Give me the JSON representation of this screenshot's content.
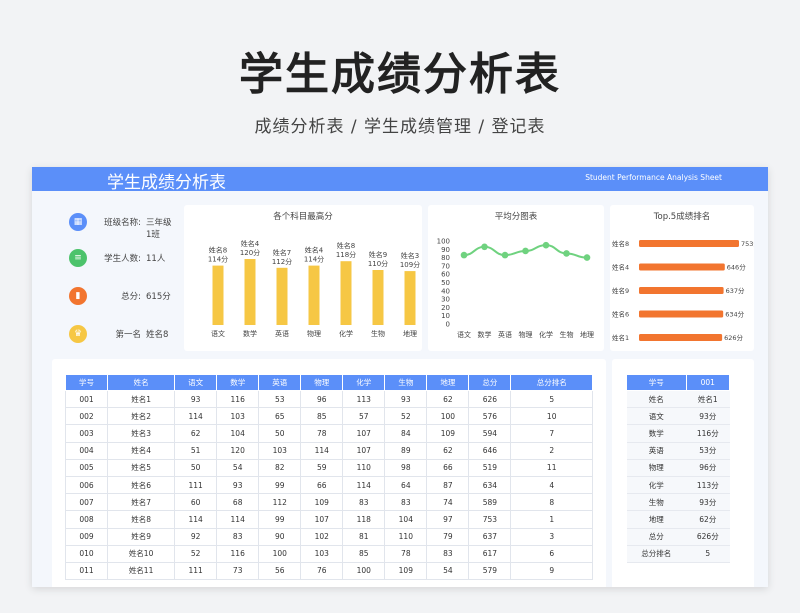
{
  "page": {
    "title": "学生成绩分析表",
    "subtitle": "成绩分析表 / 学生成绩管理 / 登记表"
  },
  "banner": {
    "title": "学生成绩分析表",
    "subtitle_en": "Student Performance Analysis Sheet"
  },
  "info": {
    "items": [
      {
        "label": "班级名称:",
        "value": "三年级1班",
        "icon": "table-icon",
        "color": "#5b8ff9"
      },
      {
        "label": "学生人数:",
        "value": "11人",
        "icon": "layers-icon",
        "color": "#4cc36b"
      },
      {
        "label": "总分:",
        "value": "615分",
        "icon": "bar-chart-icon",
        "color": "#f2752f"
      },
      {
        "label": "第一名",
        "value": "姓名8",
        "icon": "trophy-icon",
        "color": "#f6c744"
      }
    ]
  },
  "charts": {
    "max_title": "各个科目最高分",
    "avg_title": "平均分图表",
    "top_title": "Top.5成绩排名"
  },
  "chart_data": [
    {
      "type": "bar",
      "title": "各个科目最高分",
      "categories": [
        "语文",
        "数学",
        "英语",
        "物理",
        "化学",
        "生物",
        "地理"
      ],
      "names": [
        "姓名8",
        "姓名4",
        "姓名7",
        "姓名4",
        "姓名8",
        "姓名9",
        "姓名3"
      ],
      "labels": [
        "114分",
        "120分",
        "112分",
        "114分",
        "118分",
        "110分",
        "109分"
      ],
      "values": [
        114,
        120,
        112,
        114,
        118,
        110,
        109
      ],
      "color": "#f6c744"
    },
    {
      "type": "line",
      "title": "平均分图表",
      "categories": [
        "语文",
        "数学",
        "英语",
        "物理",
        "化学",
        "生物",
        "地理"
      ],
      "values": [
        83,
        93,
        83,
        88,
        95,
        85,
        80
      ],
      "ylim": [
        0,
        100
      ],
      "yticks": [
        "0",
        "10",
        "20",
        "30",
        "40",
        "50",
        "60",
        "70",
        "80",
        "90",
        "100"
      ],
      "color": "#6fd27f"
    },
    {
      "type": "bar",
      "orientation": "horizontal",
      "title": "Top.5成绩排名",
      "categories": [
        "姓名8",
        "姓名4",
        "姓名9",
        "姓名6",
        "姓名1"
      ],
      "values": [
        753,
        646,
        637,
        634,
        626
      ],
      "labels": [
        "753分",
        "646分",
        "637分",
        "634分",
        "626分"
      ],
      "color": "#f2752f"
    }
  ],
  "main_table": {
    "headers": [
      "学号",
      "姓名",
      "语文",
      "数学",
      "英语",
      "物理",
      "化学",
      "生物",
      "地理",
      "总分",
      "总分排名"
    ],
    "rows": [
      [
        "001",
        "姓名1",
        "93",
        "116",
        "53",
        "96",
        "113",
        "93",
        "62",
        "626",
        "5"
      ],
      [
        "002",
        "姓名2",
        "114",
        "103",
        "65",
        "85",
        "57",
        "52",
        "100",
        "576",
        "10"
      ],
      [
        "003",
        "姓名3",
        "62",
        "104",
        "50",
        "78",
        "107",
        "84",
        "109",
        "594",
        "7"
      ],
      [
        "004",
        "姓名4",
        "51",
        "120",
        "103",
        "114",
        "107",
        "89",
        "62",
        "646",
        "2"
      ],
      [
        "005",
        "姓名5",
        "50",
        "54",
        "82",
        "59",
        "110",
        "98",
        "66",
        "519",
        "11"
      ],
      [
        "006",
        "姓名6",
        "111",
        "93",
        "99",
        "66",
        "114",
        "64",
        "87",
        "634",
        "4"
      ],
      [
        "007",
        "姓名7",
        "60",
        "68",
        "112",
        "109",
        "83",
        "83",
        "74",
        "589",
        "8"
      ],
      [
        "008",
        "姓名8",
        "114",
        "114",
        "99",
        "107",
        "118",
        "104",
        "97",
        "753",
        "1"
      ],
      [
        "009",
        "姓名9",
        "92",
        "83",
        "90",
        "102",
        "81",
        "110",
        "79",
        "637",
        "3"
      ],
      [
        "010",
        "姓名10",
        "52",
        "116",
        "100",
        "103",
        "85",
        "78",
        "83",
        "617",
        "6"
      ],
      [
        "011",
        "姓名11",
        "111",
        "73",
        "56",
        "76",
        "100",
        "109",
        "54",
        "579",
        "9"
      ]
    ]
  },
  "detail": {
    "header_label": "学号",
    "header_value": "001",
    "rows": [
      [
        "姓名",
        "姓名1"
      ],
      [
        "语文",
        "93分"
      ],
      [
        "数学",
        "116分"
      ],
      [
        "英语",
        "53分"
      ],
      [
        "物理",
        "96分"
      ],
      [
        "化学",
        "113分"
      ],
      [
        "生物",
        "93分"
      ],
      [
        "地理",
        "62分"
      ],
      [
        "总分",
        "626分"
      ],
      [
        "总分排名",
        "5"
      ]
    ]
  }
}
